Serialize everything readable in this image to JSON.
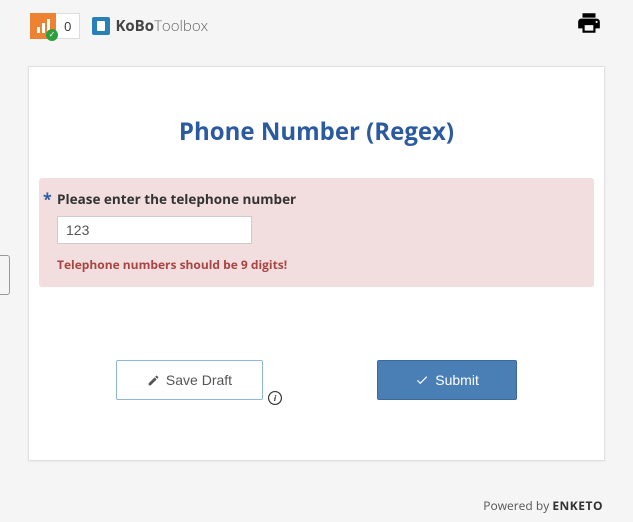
{
  "header": {
    "queue_count": "0",
    "brand_bold": "KoBo",
    "brand_light": "Toolbox"
  },
  "form": {
    "title": "Phone Number (Regex)",
    "question": {
      "label": "Please enter the telephone number",
      "value": "123",
      "error": "Telephone numbers should be 9 digits!"
    },
    "buttons": {
      "save_draft": "Save Draft",
      "submit": "Submit"
    }
  },
  "footer": {
    "powered_by": "Powered by ",
    "brand": "ENKETO"
  }
}
